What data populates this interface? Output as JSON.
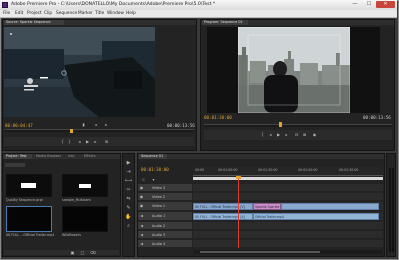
{
  "window": {
    "title": "Adobe Premiere Pro - C:\\Users\\DONATELLO\\My Documents\\Adobe\\Premiere Pro\\5.0\\Test *",
    "minimize_glyph": "—",
    "maximize_glyph": "☐",
    "close_glyph": "✕"
  },
  "menubar": {
    "items": [
      "File",
      "Edit",
      "Project",
      "Clip",
      "Sequence",
      "Marker",
      "Title",
      "Window",
      "Help"
    ]
  },
  "source_monitor": {
    "tab_label": "Source: Sparkle Sequence",
    "current_timecode": "00:00:04:47",
    "duration_timecode": "00:00:13:56"
  },
  "program_monitor": {
    "tab_label": "Program: Sequence 01",
    "current_timecode": "00:01:38:00",
    "duration_timecode": "00:00:13:56"
  },
  "project_panel": {
    "tabs": [
      "Project: Test",
      "Media Browser",
      "Info",
      "Effects"
    ],
    "items": [
      {
        "label": "Quality Sequence.prpr"
      },
      {
        "label": "sample_Multicam"
      },
      {
        "label": "00 FULL ...Official Trailer.mp4"
      },
      {
        "label": "Wildflowers"
      }
    ]
  },
  "tools": [
    "▶",
    "⇥",
    "⟷",
    "✂",
    "⇋",
    "✎",
    "✋",
    "⌕"
  ],
  "timeline": {
    "tab_label": "Sequence 01",
    "timecode": "00:01:38:00",
    "ruler_ticks": [
      "00:00",
      "00:01:00:00",
      "00:01:30:00",
      "00:02:00:00",
      "00:02:30:00"
    ],
    "tracks": [
      {
        "name": "Video 3"
      },
      {
        "name": "Video 2"
      },
      {
        "name": "Video 1"
      },
      {
        "name": "Audio 1"
      },
      {
        "name": "Audio 2"
      },
      {
        "name": "Audio 3"
      },
      {
        "name": "Audio 4"
      }
    ],
    "clips": {
      "v1_a": "00 FULL - Official Trailer.mp4 [V]",
      "v1_fx": "Sparkle Sparkle",
      "a1_a": "00 FULL - Official Trailer.mp4 [A]",
      "a1_b": "Official Trailer.mp4"
    }
  },
  "colors": {
    "timecode": "#e0a530",
    "clip_video": "#8aa7cd",
    "clip_effect": "#c88fc8",
    "playhead": "#e0a530"
  }
}
